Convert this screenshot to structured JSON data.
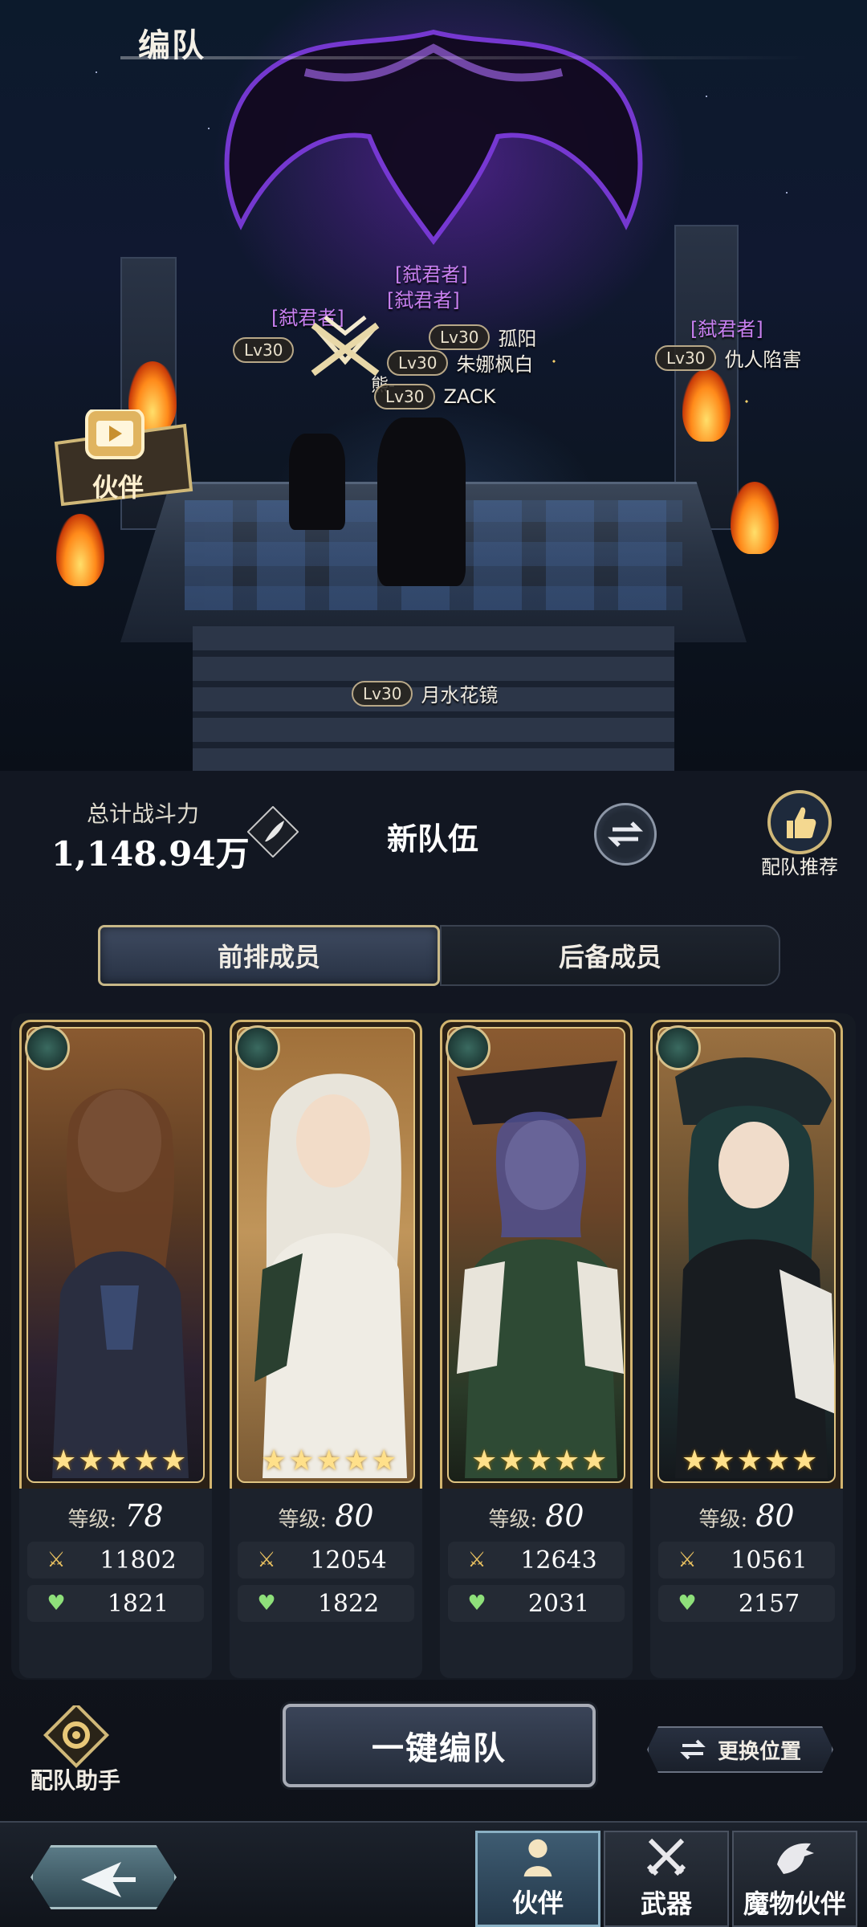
{
  "page": {
    "title": "编队"
  },
  "scene": {
    "characters": [
      {
        "title": "[弑君者]",
        "level": "Lv30",
        "name": "孤阳"
      },
      {
        "title": "[弑君者]",
        "level": "Lv30",
        "name": "朱娜枫白"
      },
      {
        "title": "[弑君者]",
        "level": "Lv30",
        "name": "熊-"
      },
      {
        "title": "",
        "level": "Lv30",
        "name": "ZACK"
      },
      {
        "title": "[弑君者]",
        "level": "Lv30",
        "name": "仇人陷害"
      },
      {
        "title": "",
        "level": "Lv30",
        "name": "月水花镜"
      }
    ],
    "companion_button": "伙伴"
  },
  "team": {
    "power_label": "总计战斗力",
    "power_value": "1,148.94万",
    "name": "新队伍",
    "recommend_label": "配队推荐"
  },
  "tabs": [
    {
      "label": "前排成员",
      "active": true
    },
    {
      "label": "后备成员",
      "active": false
    }
  ],
  "members": [
    {
      "stars": 5,
      "level_label": "等级:",
      "level": "78",
      "attack": "11802",
      "hp": "1821",
      "palette": [
        "#8a5a30",
        "#2a2030"
      ]
    },
    {
      "stars": 5,
      "level_label": "等级:",
      "level": "80",
      "attack": "12054",
      "hp": "1822",
      "palette": [
        "#c0955a",
        "#e8e4da"
      ]
    },
    {
      "stars": 5,
      "level_label": "等级:",
      "level": "80",
      "attack": "12643",
      "hp": "2031",
      "palette": [
        "#8a5a30",
        "#2a3a28"
      ]
    },
    {
      "stars": 5,
      "level_label": "等级:",
      "level": "80",
      "attack": "10561",
      "hp": "2157",
      "palette": [
        "#9a7040",
        "#1c2a2c"
      ]
    }
  ],
  "actions": {
    "assistant_label": "配队助手",
    "one_key_label": "一键编队",
    "swap_position_label": "更换位置"
  },
  "nav": [
    {
      "label": "伙伴",
      "active": true,
      "icon": "person-icon"
    },
    {
      "label": "武器",
      "active": false,
      "icon": "crossed-swords-icon"
    },
    {
      "label": "魔物伙伴",
      "active": false,
      "icon": "dragon-icon"
    }
  ],
  "colors": {
    "accent_gold": "#d2b46e",
    "hp_green": "#8ee07a",
    "attack_gold": "#e8c060",
    "title_purple": "#c880f0"
  }
}
